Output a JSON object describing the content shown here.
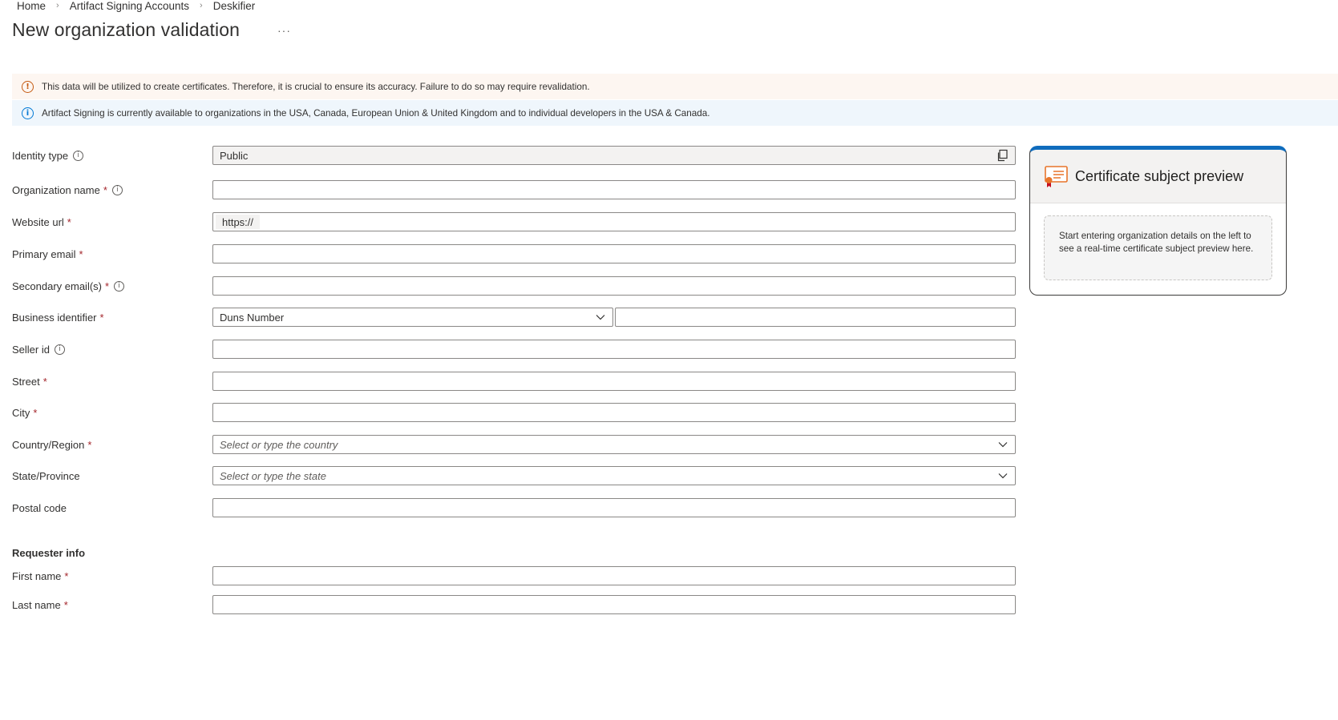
{
  "breadcrumb": [
    "Home",
    "Artifact Signing Accounts",
    "Deskifier"
  ],
  "page_title": "New organization validation",
  "more_label": "···",
  "banners": {
    "warning": "This data will be utilized to create certificates. Therefore, it is crucial to ensure its accuracy. Failure to do so may require revalidation.",
    "info": "Artifact Signing is currently available to organizations in the USA, Canada, European Union & United Kingdom and to individual developers in the USA & Canada."
  },
  "form": {
    "identity_type": {
      "label": "Identity type",
      "value": "Public"
    },
    "organization_name": {
      "label": "Organization name",
      "value": ""
    },
    "website_url": {
      "label": "Website url",
      "prefix": "https://",
      "value": ""
    },
    "primary_email": {
      "label": "Primary email",
      "value": ""
    },
    "secondary_email": {
      "label": "Secondary email(s)",
      "value": ""
    },
    "business_identifier": {
      "label": "Business identifier",
      "type_value": "Duns Number",
      "value": ""
    },
    "seller_id": {
      "label": "Seller id",
      "value": ""
    },
    "street": {
      "label": "Street",
      "value": ""
    },
    "city": {
      "label": "City",
      "value": ""
    },
    "country": {
      "label": "Country/Region",
      "placeholder": "Select or type the country"
    },
    "state": {
      "label": "State/Province",
      "placeholder": "Select or type the state"
    },
    "postal_code": {
      "label": "Postal code",
      "value": ""
    }
  },
  "requester": {
    "heading": "Requester info",
    "first_name_label": "First name",
    "last_name_label": "Last name"
  },
  "required_marker": "*",
  "info_marker": "i",
  "preview": {
    "title": "Certificate subject preview",
    "body": "Start entering organization details on the left to see a real-time certificate subject preview here."
  },
  "colors": {
    "warning_bg": "#fdf6f1",
    "warning_icon": "#c55a11",
    "info_bg": "#eff6fc",
    "info_icon": "#0078d4",
    "required": "#a4262c",
    "preview_accent": "#0f6cbd"
  }
}
